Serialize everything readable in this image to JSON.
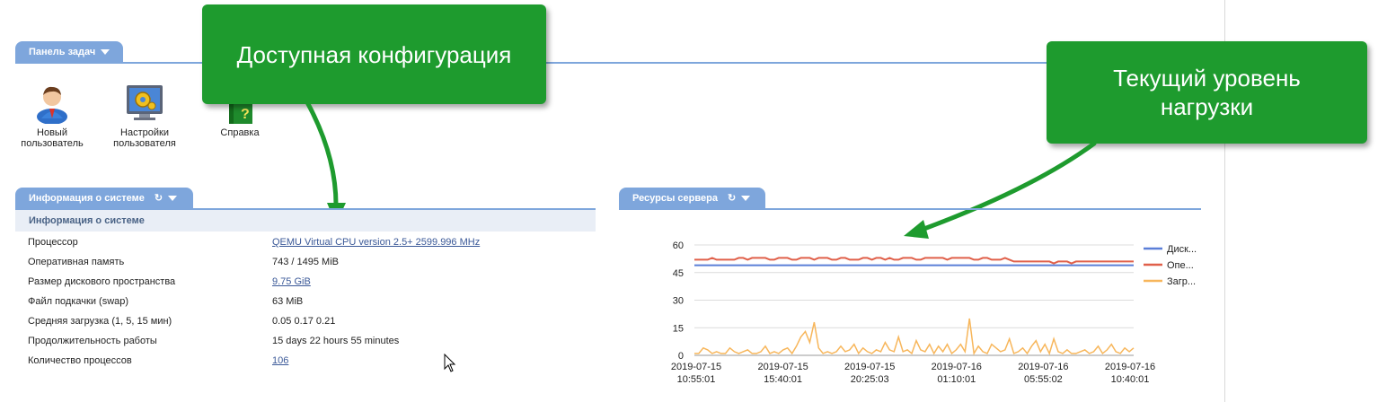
{
  "taskbar": {
    "tab_label": "Панель задач",
    "items": [
      {
        "label_line1": "Новый",
        "label_line2": "пользователь",
        "icon": "user-icon"
      },
      {
        "label_line1": "Настройки",
        "label_line2": "пользователя",
        "icon": "settings-monitor-icon"
      },
      {
        "label_line1": "Справка",
        "label_line2": "",
        "icon": "help-book-icon"
      }
    ]
  },
  "callouts": {
    "config": "Доступная конфигурация",
    "load_line1": "Текущий уровень",
    "load_line2": "нагрузки"
  },
  "sysinfo": {
    "tab_label": "Информация о системе",
    "subheader": "Информация о системе",
    "rows": [
      {
        "label": "Процессор",
        "value": "QEMU Virtual CPU version 2.5+ 2599.996 MHz",
        "link": true
      },
      {
        "label": "Оперативная память",
        "value": "743 / 1495 MiB",
        "link": false
      },
      {
        "label": "Размер дискового пространства",
        "value": "9.75 GiB",
        "link": true
      },
      {
        "label": "Файл подкачки (swap)",
        "value": "63 MiB",
        "link": false
      },
      {
        "label": "Средняя загрузка (1, 5, 15 мин)",
        "value": "0.05 0.17 0.21",
        "link": false
      },
      {
        "label": "Продолжительность работы",
        "value": "15 days 22 hours 55 minutes",
        "link": false
      },
      {
        "label": "Количество процессов",
        "value": "106",
        "link": true
      }
    ]
  },
  "resources": {
    "tab_label": "Ресурсы сервера"
  },
  "chart_data": {
    "type": "line",
    "ylim": [
      0,
      60
    ],
    "yticks": [
      "60",
      "45",
      "30",
      "15",
      "0"
    ],
    "x_ticks": [
      {
        "date": "2019-07-15",
        "time": "10:55:01"
      },
      {
        "date": "2019-07-15",
        "time": "15:40:01"
      },
      {
        "date": "2019-07-15",
        "time": "20:25:03"
      },
      {
        "date": "2019-07-16",
        "time": "01:10:01"
      },
      {
        "date": "2019-07-16",
        "time": "05:55:02"
      },
      {
        "date": "2019-07-16",
        "time": "10:40:01"
      }
    ],
    "grid": true,
    "legend_position": "right",
    "series": [
      {
        "name": "Диск...",
        "color": "#5b7fd8",
        "values": [
          49,
          49,
          49,
          49,
          49,
          49,
          49,
          49,
          49,
          49,
          49,
          49,
          49,
          49,
          49,
          49,
          49,
          49,
          49,
          49,
          49,
          49,
          49,
          49,
          49,
          49,
          49,
          49,
          49,
          49,
          49,
          49,
          49,
          49,
          49,
          49,
          49,
          49,
          49,
          49,
          49,
          49,
          49,
          49,
          49,
          49,
          49,
          49,
          49,
          49,
          49,
          49,
          49,
          49,
          49,
          49,
          49,
          49,
          49,
          49,
          49,
          49,
          49,
          49,
          49,
          49,
          49,
          49,
          49,
          49,
          49,
          49,
          49,
          49,
          49,
          49,
          49,
          49,
          49,
          49,
          49,
          49,
          49,
          49,
          49,
          49,
          49,
          49,
          49,
          49,
          49,
          49,
          49,
          49,
          49,
          49,
          49,
          49,
          49,
          49
        ]
      },
      {
        "name": "Опе...",
        "color": "#e0604a",
        "values": [
          52,
          52,
          52,
          52,
          53,
          52,
          52,
          52,
          52,
          52,
          53,
          53,
          52,
          53,
          53,
          53,
          53,
          52,
          52,
          53,
          53,
          53,
          52,
          52,
          53,
          53,
          53,
          52,
          53,
          53,
          53,
          52,
          52,
          53,
          53,
          52,
          52,
          52,
          53,
          53,
          52,
          53,
          53,
          52,
          53,
          52,
          52,
          53,
          53,
          53,
          52,
          52,
          53,
          53,
          53,
          53,
          53,
          52,
          53,
          53,
          53,
          53,
          53,
          52,
          52,
          53,
          53,
          52,
          52,
          52,
          53,
          52,
          51,
          51,
          51,
          51,
          51,
          51,
          51,
          51,
          51,
          50,
          51,
          51,
          51,
          50,
          51,
          51,
          51,
          51,
          51,
          51,
          51,
          51,
          51,
          51,
          51,
          51,
          51,
          51
        ]
      },
      {
        "name": "Загр...",
        "color": "#f7b65b",
        "values": [
          1,
          1,
          4,
          3,
          1,
          2,
          1,
          1,
          4,
          2,
          1,
          2,
          3,
          1,
          1,
          2,
          5,
          1,
          2,
          1,
          3,
          4,
          1,
          5,
          10,
          13,
          7,
          18,
          4,
          1,
          2,
          1,
          2,
          5,
          2,
          3,
          6,
          1,
          4,
          2,
          1,
          3,
          2,
          7,
          3,
          2,
          10,
          2,
          3,
          1,
          8,
          3,
          2,
          6,
          1,
          5,
          2,
          6,
          1,
          3,
          6,
          2,
          20,
          1,
          5,
          2,
          1,
          6,
          4,
          2,
          3,
          9,
          1,
          2,
          4,
          1,
          5,
          8,
          2,
          6,
          1,
          9,
          2,
          1,
          3,
          1,
          1,
          2,
          3,
          1,
          2,
          5,
          1,
          3,
          6,
          2,
          1,
          4,
          2,
          4
        ]
      }
    ]
  }
}
